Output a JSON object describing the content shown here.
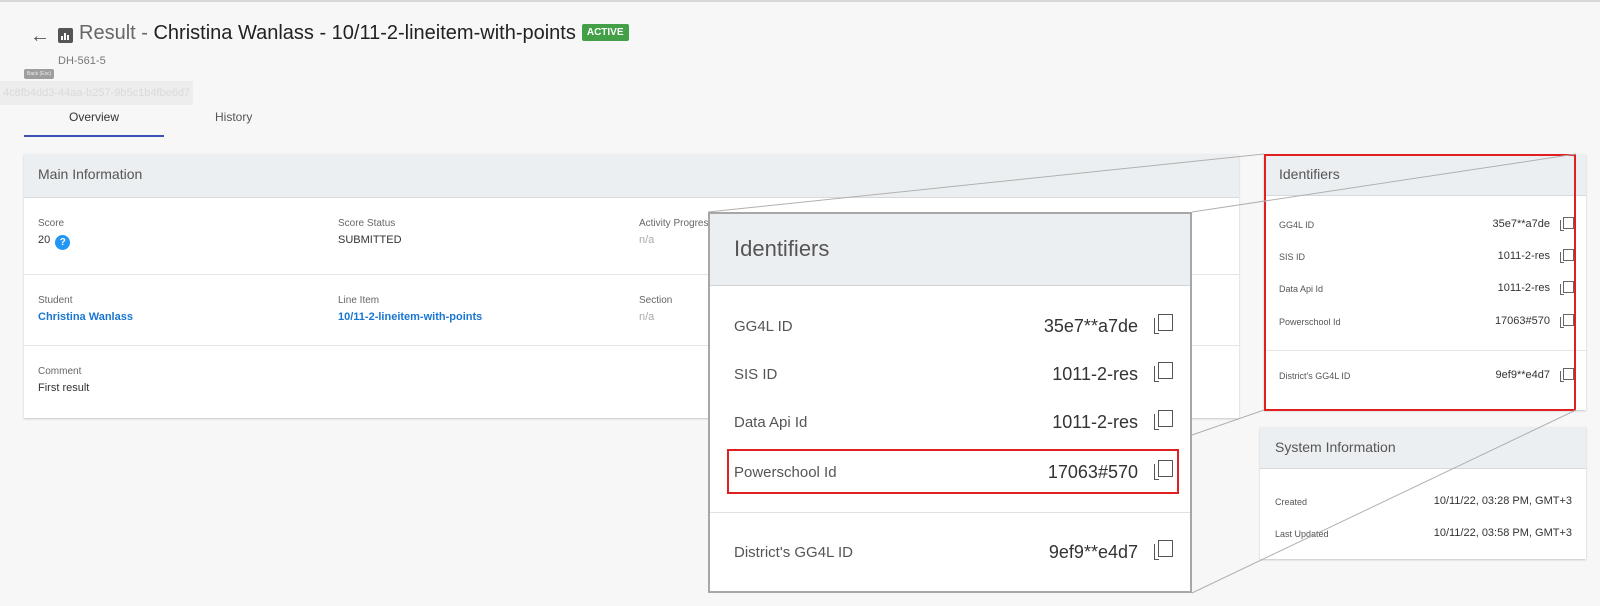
{
  "header": {
    "title_prefix": "Result - ",
    "title_name": "Christina Wanlass - 10/11-2-lineitem-with-points",
    "status_badge": "ACTIVE",
    "sub_id": "DH-561-5",
    "tooltip": "Back (Esc)",
    "ghost_guid": "4c8fb4dd3-44aa-b257-9b5c1b4fbe6d7"
  },
  "tabs": [
    {
      "label": "Overview",
      "active": true
    },
    {
      "label": "History",
      "active": false
    }
  ],
  "main_info": {
    "title": "Main Information",
    "score_label": "Score",
    "score_value": "20",
    "score_status_label": "Score Status",
    "score_status_value": "SUBMITTED",
    "activity_progress_label": "Activity Progress",
    "activity_progress_value": "n/a",
    "student_label": "Student",
    "student_value": "Christina Wanlass",
    "line_item_label": "Line Item",
    "line_item_value": "10/11-2-lineitem-with-points",
    "section_label": "Section",
    "section_value": "n/a",
    "comment_label": "Comment",
    "comment_value": "First result"
  },
  "identifiers": {
    "title": "Identifiers",
    "items": [
      {
        "label": "GG4L ID",
        "value": "35e7**a7de"
      },
      {
        "label": "SIS ID",
        "value": "1011-2-res"
      },
      {
        "label": "Data Api Id",
        "value": "1011-2-res"
      },
      {
        "label": "Powerschool Id",
        "value": "17063#570"
      },
      {
        "label": "District's GG4L ID",
        "value": "9ef9**e4d7"
      }
    ]
  },
  "system_info": {
    "title": "System Information",
    "created_label": "Created",
    "created_value": "10/11/22, 03:28 PM, GMT+3",
    "updated_label": "Last Updated",
    "updated_value": "10/11/22, 03:58 PM, GMT+3"
  },
  "colors": {
    "accent": "#3f51b5",
    "link": "#1976d2",
    "badge": "#43a047",
    "highlight": "#e02020"
  }
}
